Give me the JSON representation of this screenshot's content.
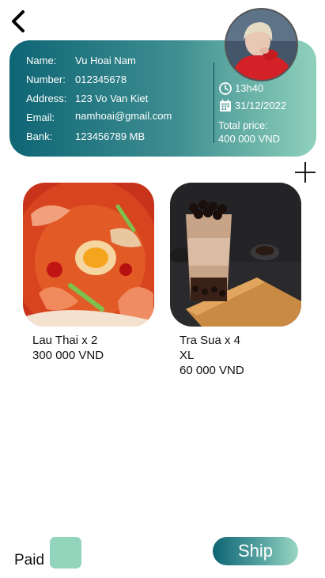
{
  "nav": {
    "back_icon": "chevron-left-icon"
  },
  "customer": {
    "name_label": "Name:",
    "name": "Vu Hoai Nam",
    "number_label": "Number:",
    "number": "012345678",
    "address_label": "Address:",
    "address": "123 Vo Van Kiet",
    "email_label": "Email:",
    "email": "namhoai@gmail.com",
    "bank_label": "Bank:",
    "bank": "123456789 MB"
  },
  "order": {
    "time": "13h40",
    "date": "31/12/2022",
    "total_label": "Total price:",
    "total": "400 000 VND"
  },
  "products": [
    {
      "name": "Lau Thai x 2",
      "price": "300 000 VND"
    },
    {
      "name": "Tra Sua x 4",
      "size": "XL",
      "price": "60 000 VND"
    }
  ],
  "footer": {
    "paid_label": "Paid",
    "ship_label": "Ship"
  },
  "colors": {
    "brand_dark": "#0e6574",
    "brand_light": "#8fd1bb",
    "paid_box": "#93d4bc"
  }
}
